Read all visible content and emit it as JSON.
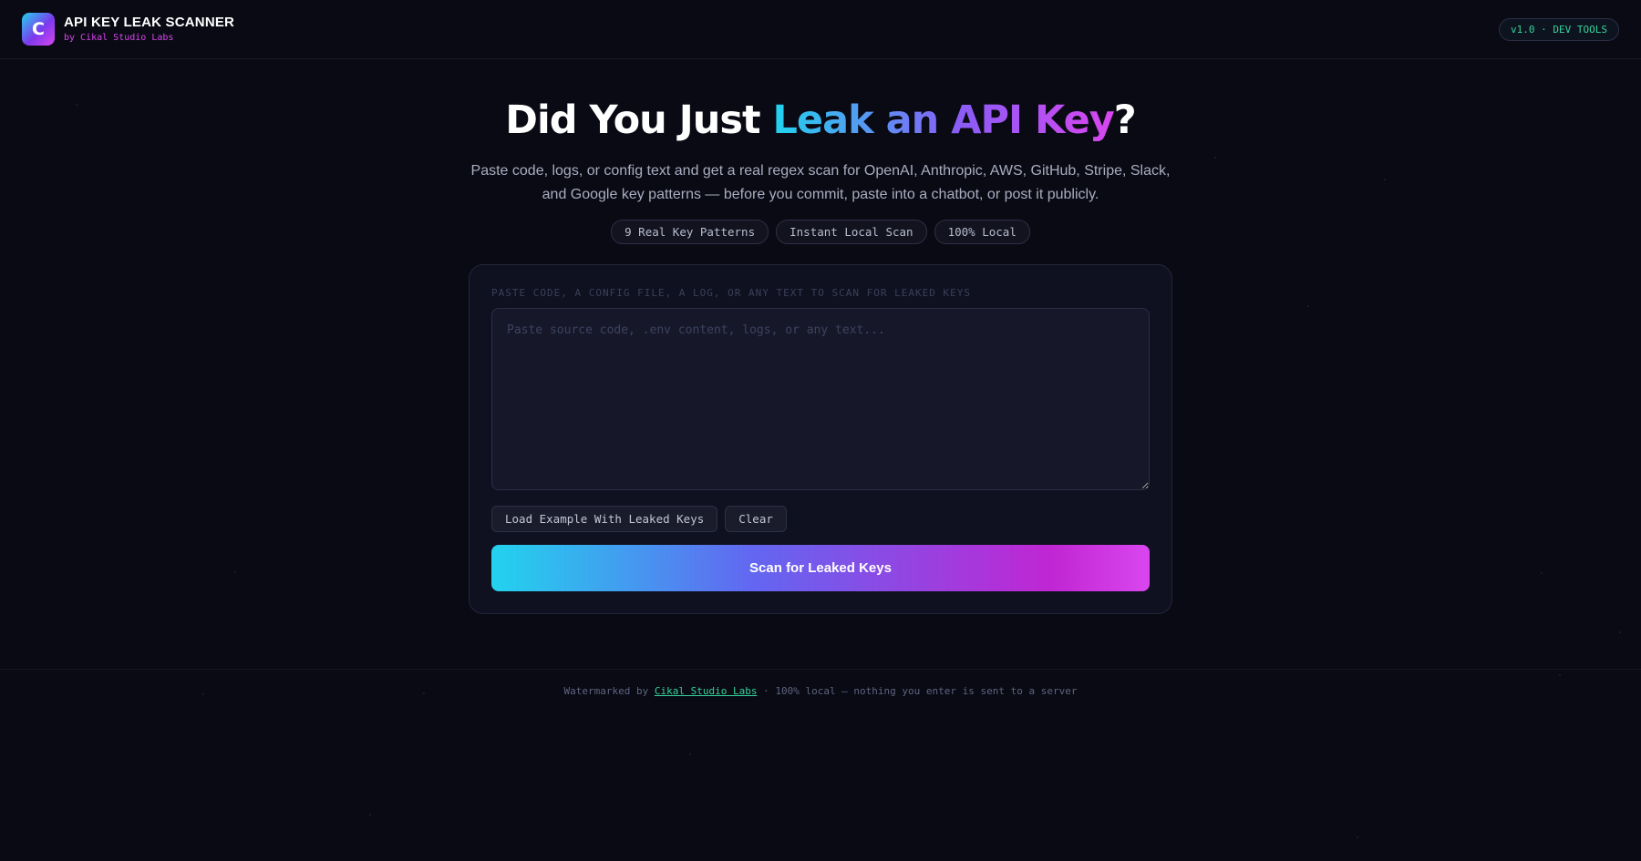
{
  "header": {
    "logo_letter": "C",
    "title": "API KEY LEAK SCANNER",
    "subtitle": "by Cikal Studio Labs",
    "version_badge": "v1.0 · DEV TOOLS"
  },
  "hero": {
    "title_prefix": "Did You Just ",
    "title_highlight": "Leak an API Key",
    "title_suffix": "?",
    "description": "Paste code, logs, or config text and get a real regex scan for OpenAI, Anthropic, AWS, GitHub, Stripe, Slack, and Google key patterns — before you commit, paste into a chatbot, or post it publicly.",
    "chips": [
      "9 Real Key Patterns",
      "Instant Local Scan",
      "100% Local"
    ]
  },
  "scanner": {
    "label": "PASTE CODE, A CONFIG FILE, A LOG, OR ANY TEXT TO SCAN FOR LEAKED KEYS",
    "value": "",
    "placeholder": "Paste source code, .env content, logs, or any text...",
    "load_example_label": "Load Example With Leaked Keys",
    "clear_label": "Clear",
    "scan_label": "Scan for Leaked Keys"
  },
  "footer": {
    "prefix": "Watermarked by ",
    "link_text": "Cikal Studio Labs",
    "suffix": " · 100% local — nothing you enter is sent to a server"
  },
  "colors": {
    "background": "#0a0a14",
    "accent_cyan": "#22d3ee",
    "accent_purple": "#8b5cf6",
    "accent_magenta": "#d946ef",
    "badge_green": "#34d399"
  }
}
